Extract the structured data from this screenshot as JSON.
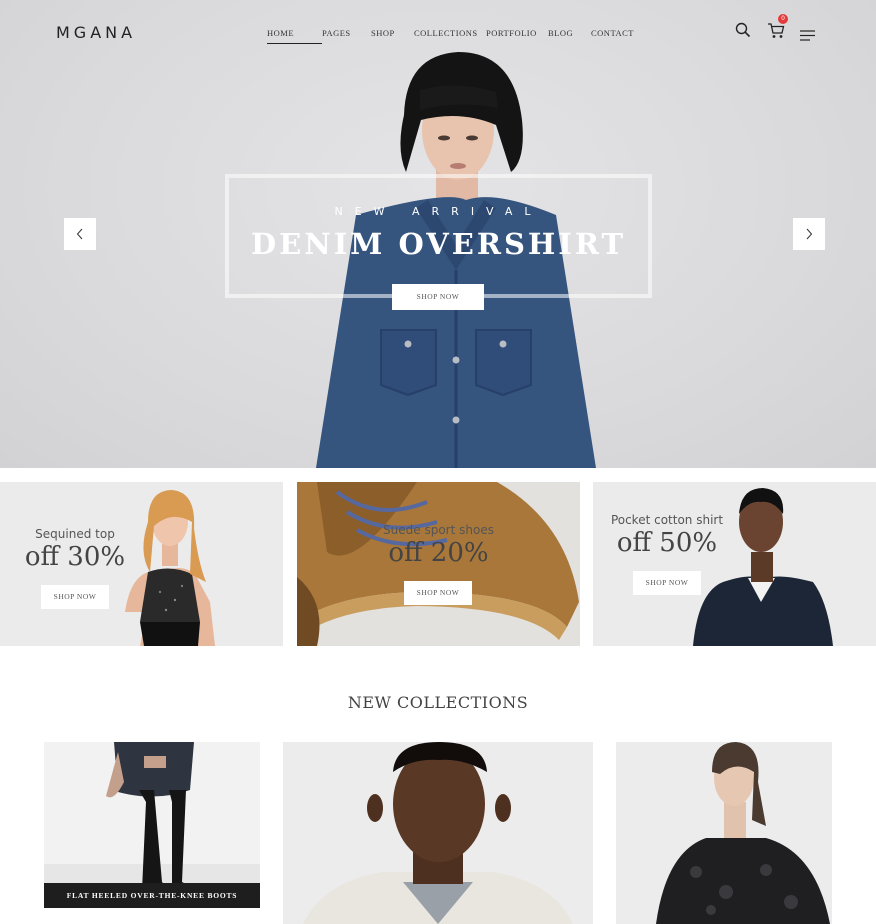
{
  "header": {
    "logo": "MGANA",
    "nav": [
      "HOME",
      "PAGES",
      "SHOP",
      "COLLECTIONS",
      "PORTFOLIO",
      "BLOG",
      "CONTACT"
    ],
    "active_nav": "HOME",
    "cart_count": "0",
    "icons": [
      "search-icon",
      "cart-icon",
      "menu-icon"
    ]
  },
  "hero": {
    "subtitle": "NEW ARRIVAL",
    "title": "DENIM OVERSHIRT",
    "button": "SHOP NOW",
    "icons": [
      "chevron-left-icon",
      "chevron-right-icon"
    ]
  },
  "banners": [
    {
      "title": "Sequined top",
      "discount": "off 30%",
      "button": "SHOP NOW"
    },
    {
      "title": "Suede sport shoes",
      "discount": "off 20%",
      "button": "SHOP NOW"
    },
    {
      "title": "Pocket cotton shirt",
      "discount": "off 50%",
      "button": "SHOP NOW"
    }
  ],
  "collections": {
    "title": "NEW COLLECTIONS",
    "items": [
      {
        "caption": "FLAT HEELED OVER-THE-KNEE BOOTS"
      }
    ]
  },
  "colors": {
    "badge": "#e43a3a",
    "caption_bg": "#1e1e1e",
    "denim": "#35557f"
  }
}
